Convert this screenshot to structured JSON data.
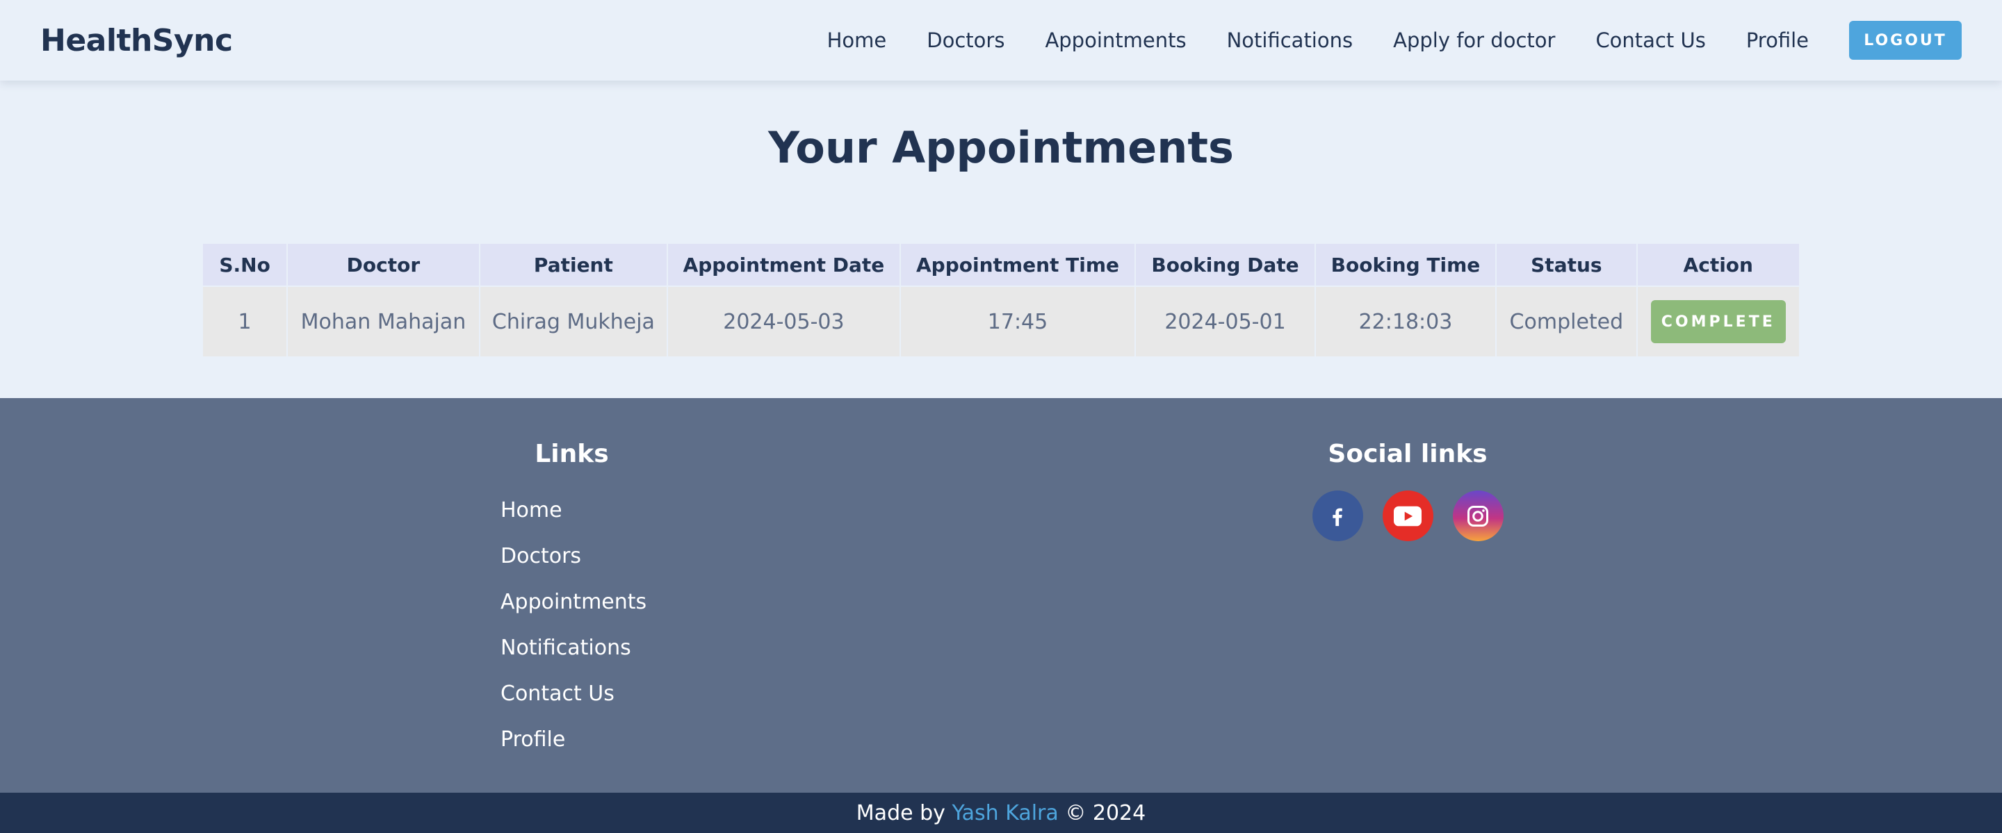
{
  "header": {
    "brand": "HealthSync",
    "nav": [
      "Home",
      "Doctors",
      "Appointments",
      "Notifications",
      "Apply for doctor",
      "Contact Us",
      "Profile"
    ],
    "logout_label": "LOGOUT"
  },
  "main": {
    "title": "Your Appointments",
    "table": {
      "columns": [
        "S.No",
        "Doctor",
        "Patient",
        "Appointment Date",
        "Appointment Time",
        "Booking Date",
        "Booking Time",
        "Status",
        "Action"
      ],
      "rows": [
        {
          "sno": "1",
          "doctor": "Mohan Mahajan",
          "patient": "Chirag Mukheja",
          "appointment_date": "2024-05-03",
          "appointment_time": "17:45",
          "booking_date": "2024-05-01",
          "booking_time": "22:18:03",
          "status": "Completed",
          "action_label": "COMPLETE"
        }
      ]
    }
  },
  "footer": {
    "links_title": "Links",
    "links": [
      "Home",
      "Doctors",
      "Appointments",
      "Notifications",
      "Contact Us",
      "Profile"
    ],
    "social_title": "Social links",
    "social": [
      {
        "name": "facebook-icon",
        "color": "#3b5998"
      },
      {
        "name": "youtube-icon",
        "color": "#e52d27"
      },
      {
        "name": "instagram-icon",
        "color": "#c13584"
      }
    ],
    "copyright": {
      "prefix": "Made by ",
      "author": "Yash Kalra",
      "suffix": " © 2024"
    }
  },
  "colors": {
    "page_bg": "#e9f0f9",
    "primary": "#213351",
    "accent": "#4ea5dd",
    "success": "#8dba7a",
    "footer_bg": "#5e6e89"
  }
}
